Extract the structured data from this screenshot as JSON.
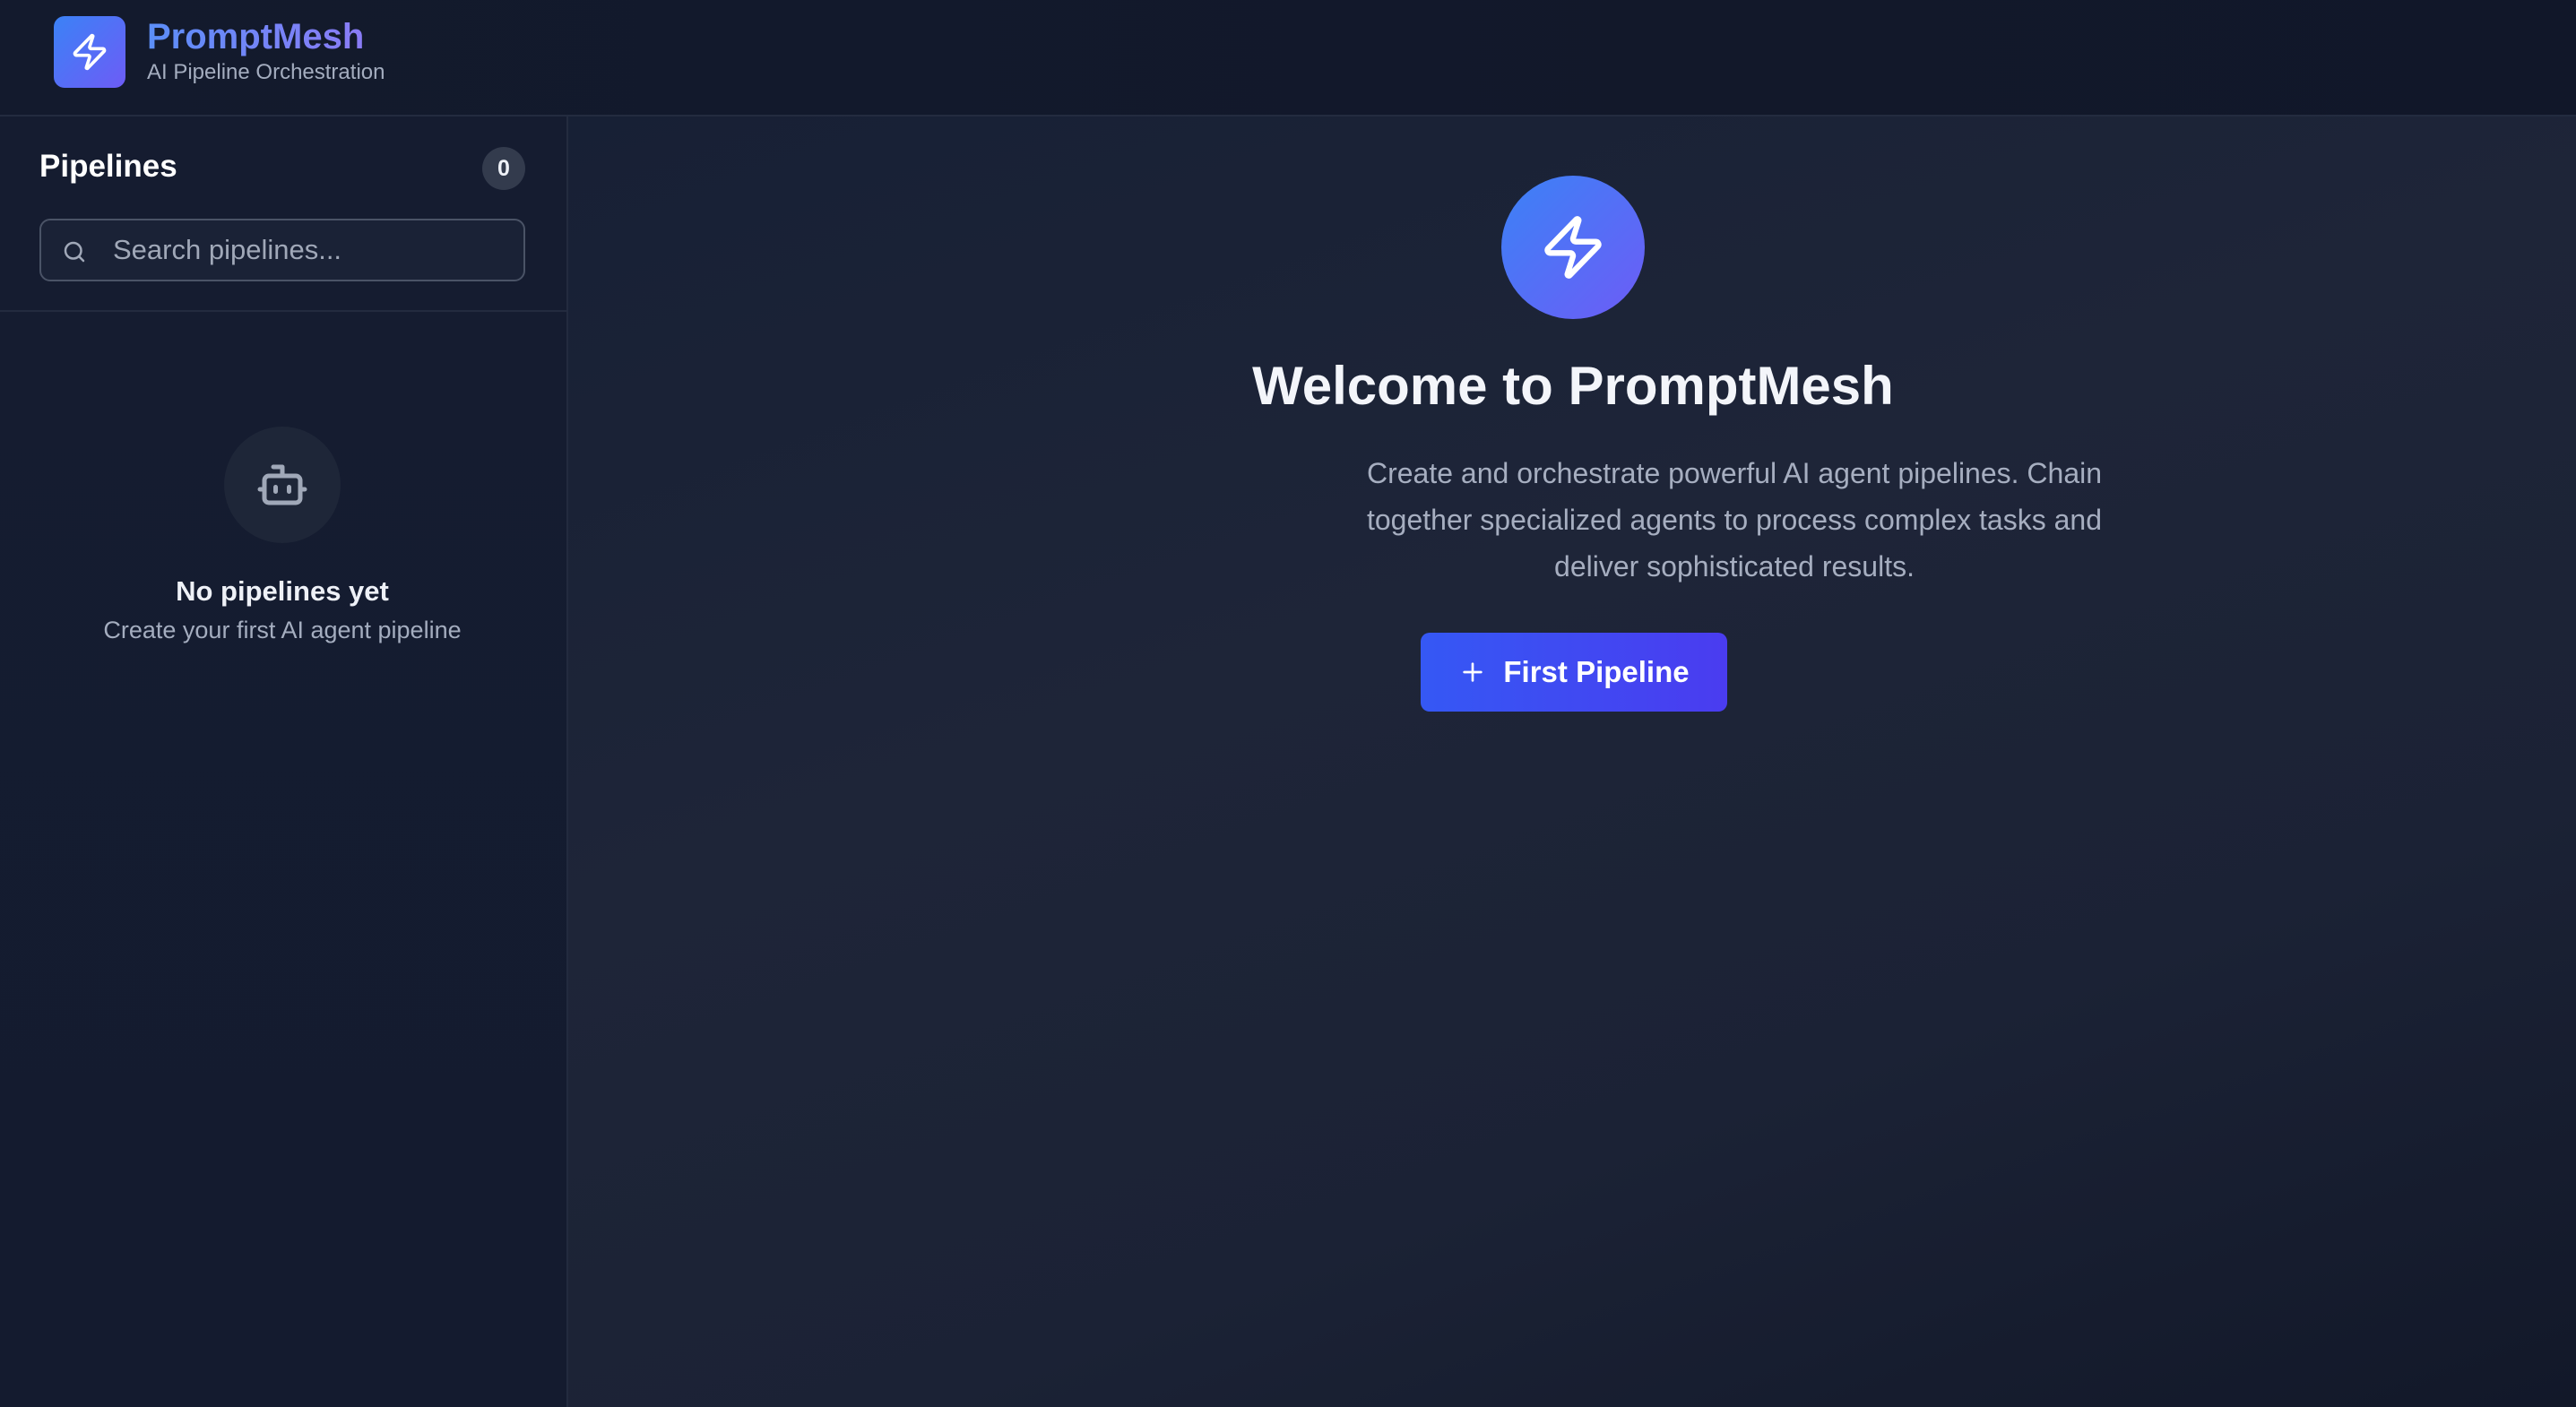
{
  "header": {
    "brand_name": "PromptMesh",
    "brand_subtitle": "AI Pipeline Orchestration",
    "logo_icon": "lightning-icon"
  },
  "sidebar": {
    "title": "Pipelines",
    "count": "0",
    "search": {
      "placeholder": "Search pipelines...",
      "value": ""
    },
    "empty_state": {
      "icon": "robot-icon",
      "title": "No pipelines yet",
      "subtitle": "Create your first AI agent pipeline"
    }
  },
  "main": {
    "hero_icon": "lightning-icon",
    "title": "Welcome to PromptMesh",
    "description": "Create and orchestrate powerful AI agent pipelines. Chain together specialized agents to process complex tasks and deliver sophisticated results.",
    "cta_label": "First Pipeline",
    "cta_icon": "plus-icon"
  },
  "colors": {
    "background": "#141b2e",
    "accent_start": "#3b82f6",
    "accent_end": "#6d5cf6",
    "button_start": "#3558f4",
    "button_end": "#4a3cf0",
    "muted_text": "#a4adbf"
  }
}
